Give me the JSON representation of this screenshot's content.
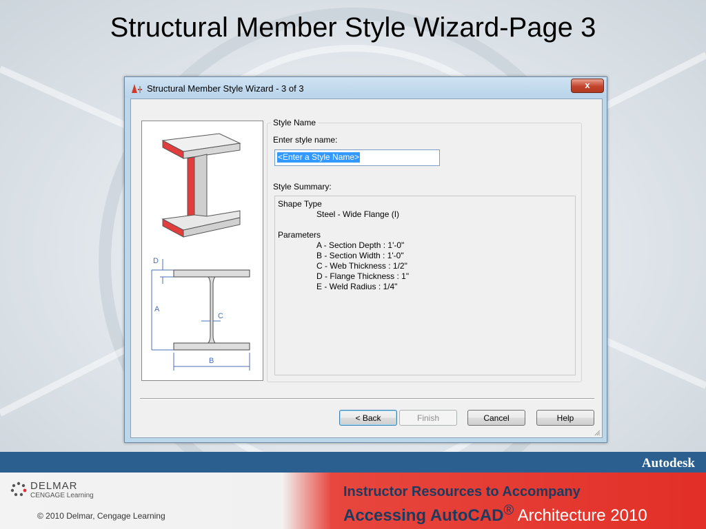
{
  "slide": {
    "title": "Structural Member Style Wizard-Page 3"
  },
  "dialog": {
    "title": "Structural Member Style Wizard - 3 of 3",
    "close_label": "x",
    "group_title": "Style Name",
    "enter_name_label": "Enter style name:",
    "name_input_value": "<Enter a Style Name>",
    "summary_label": "Style Summary:",
    "summary": {
      "shape_type_heading": "Shape Type",
      "shape_type_value": "Steel - Wide Flange (I)",
      "parameters_heading": "Parameters",
      "parameters": [
        "A - Section Depth : 1'-0\"",
        "B - Section Width : 1'-0\"",
        "C - Web Thickness : 1/2\"",
        "D - Flange Thickness : 1\"",
        "E - Weld Radius : 1/4\""
      ]
    },
    "diagram_labels": {
      "d": "D",
      "a": "A",
      "c": "C",
      "b": "B"
    },
    "buttons": {
      "back": "< Back",
      "finish": "Finish",
      "cancel": "Cancel",
      "help": "Help"
    }
  },
  "footer": {
    "brand": "Autodesk",
    "publisher_name": "DELMAR",
    "publisher_sub": "CENGAGE Learning",
    "copyright": "© 2010  Delmar, Cengage Learning",
    "resources_line1": "Instructor Resources to Accompany",
    "resources_line2_bold": "Accessing AutoCAD",
    "resources_line2_reg": "®",
    "resources_line2_light": " Architecture 2010"
  },
  "colors": {
    "flange_red": "#e23c3c",
    "footer_blue": "#2a5f8f",
    "footer_red": "#e22f27"
  }
}
